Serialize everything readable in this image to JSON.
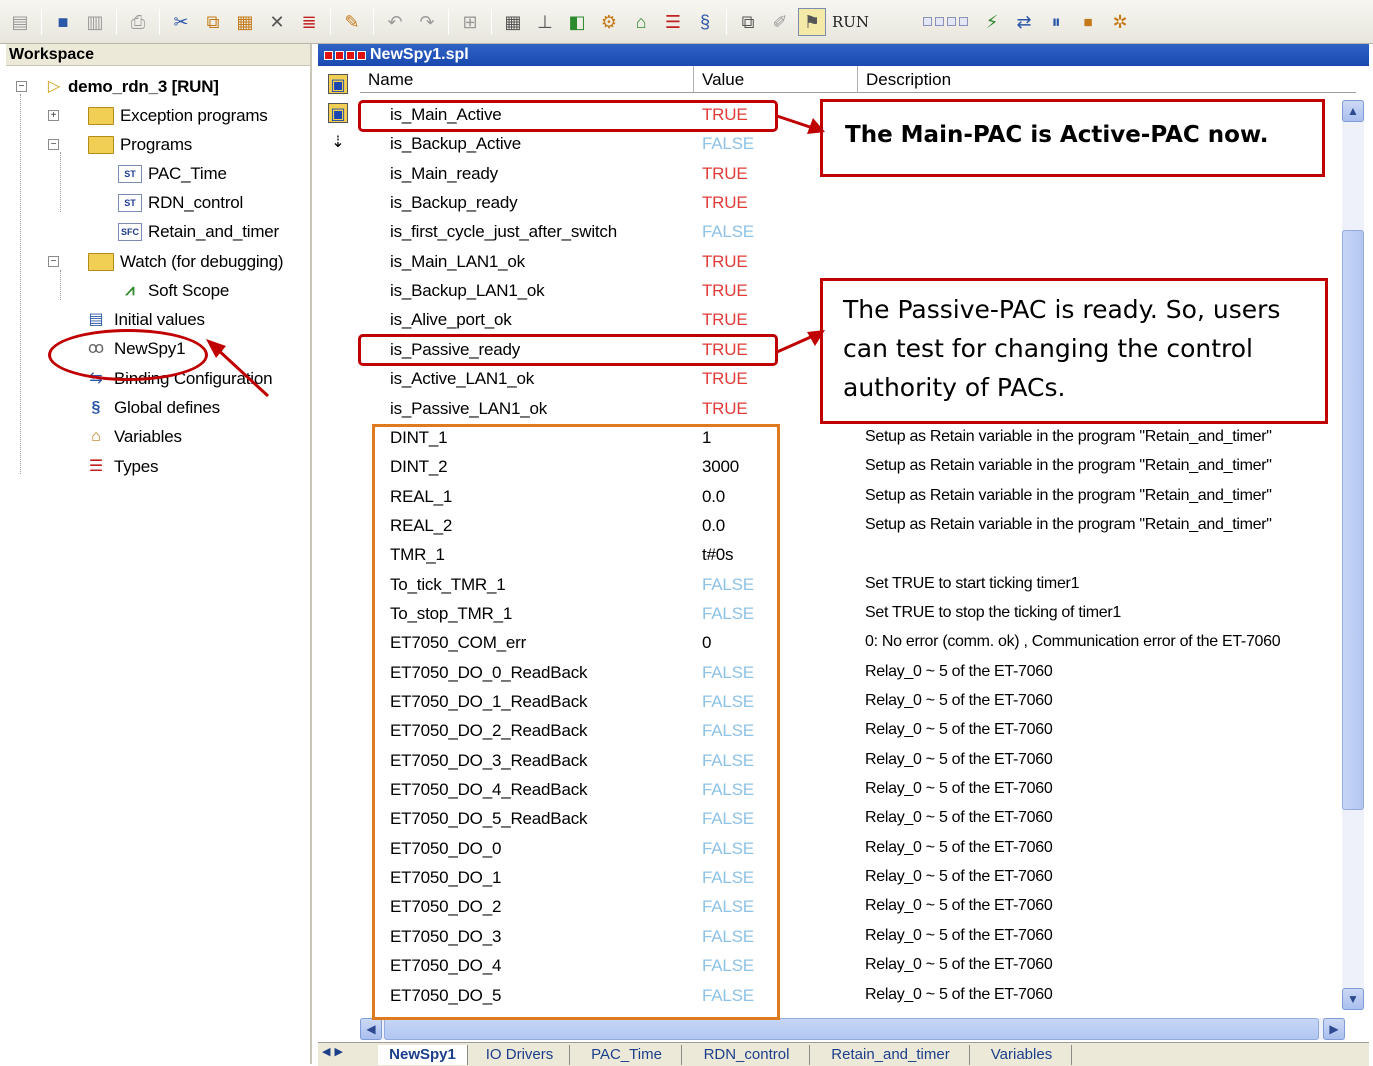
{
  "toolbar": {
    "run_label": "RUN",
    "icons": [
      "open-icon",
      "save-icon",
      "save-all-icon",
      "print-icon",
      "cut-icon",
      "copy-icon",
      "paste-icon",
      "delete-icon",
      "delete-row-icon",
      "highlight-icon",
      "undo-icon",
      "redo-icon",
      "insert-icon",
      "grid-icon",
      "network-icon",
      "io-icon",
      "settings-icon",
      "home-icon",
      "list-icon",
      "global-icon",
      "window-icon",
      "edit-icon",
      "run-icon",
      "status-icon",
      "build-icon",
      "switch-icon",
      "pause-icon",
      "stop-icon",
      "debug-icon"
    ]
  },
  "workspace": {
    "title": "Workspace",
    "project": "demo_rdn_3 [RUN]",
    "items": [
      {
        "label": "Exception programs"
      },
      {
        "label": "Programs"
      },
      {
        "label": "PAC_Time"
      },
      {
        "label": "RDN_control"
      },
      {
        "label": "Retain_and_timer"
      },
      {
        "label": "Watch (for debugging)"
      },
      {
        "label": "Soft Scope"
      },
      {
        "label": "Initial values"
      },
      {
        "label": "NewSpy1"
      },
      {
        "label": "Binding Configuration"
      },
      {
        "label": "Global defines"
      },
      {
        "label": "Variables"
      },
      {
        "label": "Types"
      }
    ],
    "icon_codes": {
      "st": "ST",
      "sfc": "SFC"
    }
  },
  "document": {
    "title": "NewSpy1.spl",
    "columns": [
      "Name",
      "Value",
      "Description"
    ],
    "rows": [
      {
        "name": "is_Main_Active",
        "value": "TRUE",
        "desc": ""
      },
      {
        "name": "is_Backup_Active",
        "value": "FALSE",
        "desc": ""
      },
      {
        "name": "is_Main_ready",
        "value": "TRUE",
        "desc": ""
      },
      {
        "name": "is_Backup_ready",
        "value": "TRUE",
        "desc": ""
      },
      {
        "name": "is_first_cycle_just_after_switch",
        "value": "FALSE",
        "desc": ""
      },
      {
        "name": "is_Main_LAN1_ok",
        "value": "TRUE",
        "desc": ""
      },
      {
        "name": "is_Backup_LAN1_ok",
        "value": "TRUE",
        "desc": ""
      },
      {
        "name": "is_Alive_port_ok",
        "value": "TRUE",
        "desc": ""
      },
      {
        "name": "is_Passive_ready",
        "value": "TRUE",
        "desc": ""
      },
      {
        "name": "is_Active_LAN1_ok",
        "value": "TRUE",
        "desc": ""
      },
      {
        "name": "is_Passive_LAN1_ok",
        "value": "TRUE",
        "desc": ""
      },
      {
        "name": "DINT_1",
        "value": "1",
        "desc": "Setup as Retain variable in the program \"Retain_and_timer\""
      },
      {
        "name": "DINT_2",
        "value": "3000",
        "desc": "Setup as Retain variable in the program \"Retain_and_timer\""
      },
      {
        "name": "REAL_1",
        "value": "0.0",
        "desc": "Setup as Retain variable in the program \"Retain_and_timer\""
      },
      {
        "name": "REAL_2",
        "value": "0.0",
        "desc": "Setup as Retain variable in the program \"Retain_and_timer\""
      },
      {
        "name": "TMR_1",
        "value": "t#0s",
        "desc": ""
      },
      {
        "name": "To_tick_TMR_1",
        "value": "FALSE",
        "desc": "Set TRUE to start ticking timer1"
      },
      {
        "name": "To_stop_TMR_1",
        "value": "FALSE",
        "desc": "Set TRUE to stop the ticking of timer1"
      },
      {
        "name": "ET7050_COM_err",
        "value": "0",
        "desc": "0: No error (comm. ok) , Communication error of the ET-7060"
      },
      {
        "name": "ET7050_DO_0_ReadBack",
        "value": "FALSE",
        "desc": "Relay_0 ~ 5 of the ET-7060"
      },
      {
        "name": "ET7050_DO_1_ReadBack",
        "value": "FALSE",
        "desc": "Relay_0 ~ 5 of the ET-7060"
      },
      {
        "name": "ET7050_DO_2_ReadBack",
        "value": "FALSE",
        "desc": "Relay_0 ~ 5 of the ET-7060"
      },
      {
        "name": "ET7050_DO_3_ReadBack",
        "value": "FALSE",
        "desc": "Relay_0 ~ 5 of the ET-7060"
      },
      {
        "name": "ET7050_DO_4_ReadBack",
        "value": "FALSE",
        "desc": "Relay_0 ~ 5 of the ET-7060"
      },
      {
        "name": "ET7050_DO_5_ReadBack",
        "value": "FALSE",
        "desc": "Relay_0 ~ 5 of the ET-7060"
      },
      {
        "name": "ET7050_DO_0",
        "value": "FALSE",
        "desc": "Relay_0 ~ 5 of the ET-7060"
      },
      {
        "name": "ET7050_DO_1",
        "value": "FALSE",
        "desc": "Relay_0 ~ 5 of the ET-7060"
      },
      {
        "name": "ET7050_DO_2",
        "value": "FALSE",
        "desc": "Relay_0 ~ 5 of the ET-7060"
      },
      {
        "name": "ET7050_DO_3",
        "value": "FALSE",
        "desc": "Relay_0 ~ 5 of the ET-7060"
      },
      {
        "name": "ET7050_DO_4",
        "value": "FALSE",
        "desc": "Relay_0 ~ 5 of the ET-7060"
      },
      {
        "name": "ET7050_DO_5",
        "value": "FALSE",
        "desc": "Relay_0 ~ 5 of the ET-7060"
      }
    ]
  },
  "tabs": [
    "NewSpy1",
    "IO Drivers",
    "PAC_Time",
    "RDN_control",
    "Retain_and_timer",
    "Variables"
  ],
  "annotations": {
    "callout1": "The Main-PAC is Active-PAC now.",
    "callout2": "The Passive-PAC is ready. So, users can test for changing the control authority of PACs."
  },
  "colors": {
    "true": "#e23b3b",
    "false": "#8ec2e6",
    "highlight": "#c00000",
    "group": "#e07a1f",
    "title_bar": "#1a48b0"
  }
}
